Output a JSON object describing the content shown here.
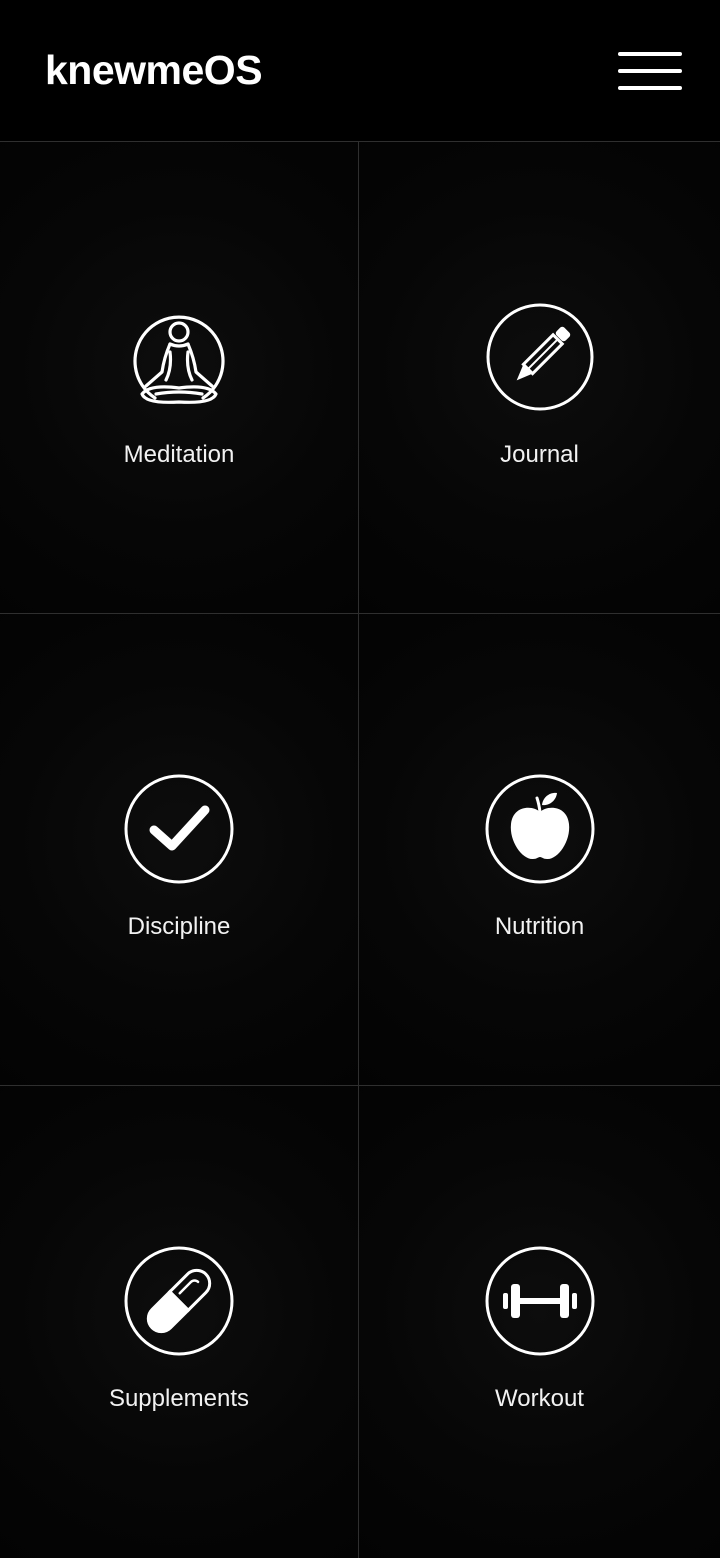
{
  "app": {
    "title": "knewmeOS"
  },
  "header": {
    "menu_icon": "hamburger-menu-icon"
  },
  "tiles": [
    {
      "label": "Meditation",
      "icon": "meditation-icon"
    },
    {
      "label": "Journal",
      "icon": "pencil-icon"
    },
    {
      "label": "Discipline",
      "icon": "checkmark-icon"
    },
    {
      "label": "Nutrition",
      "icon": "apple-icon"
    },
    {
      "label": "Supplements",
      "icon": "pill-icon"
    },
    {
      "label": "Workout",
      "icon": "dumbbell-icon"
    }
  ],
  "colors": {
    "background": "#000000",
    "text": "#ffffff",
    "divider": "#2f2f2f"
  }
}
